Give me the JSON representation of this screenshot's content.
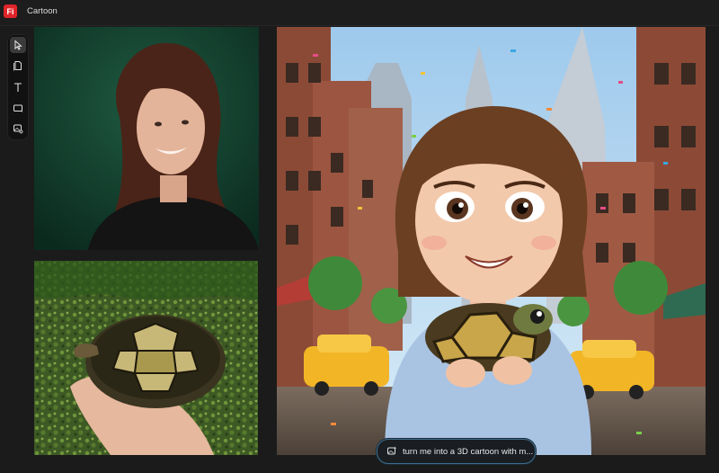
{
  "app": {
    "logo_text": "Fi",
    "title": "Cartoon"
  },
  "toolbar": {
    "tools": [
      {
        "name": "select-tool",
        "icon": "cursor-arrow-icon",
        "active": true
      },
      {
        "name": "page-tool",
        "icon": "page-icon",
        "active": false
      },
      {
        "name": "text-tool",
        "icon": "text-T-icon",
        "active": false
      },
      {
        "name": "shape-tool",
        "icon": "rectangle-icon",
        "active": false
      },
      {
        "name": "generate-tool",
        "icon": "magic-image-icon",
        "active": false
      }
    ]
  },
  "canvas": {
    "images": [
      {
        "name": "portrait-photo",
        "subject": "woman-photo"
      },
      {
        "name": "tortoise-photo",
        "subject": "tortoise-in-hand-photo"
      },
      {
        "name": "cartoon-result",
        "subject": "3d-cartoon-woman-with-tortoise"
      }
    ]
  },
  "prompt": {
    "text": "turn me into a 3D cartoon with m...",
    "icon": "generate-prompt-icon"
  },
  "colors": {
    "background": "#1b1b1b",
    "accent_border": "#3d6e8f",
    "logo": "#e0252a"
  }
}
